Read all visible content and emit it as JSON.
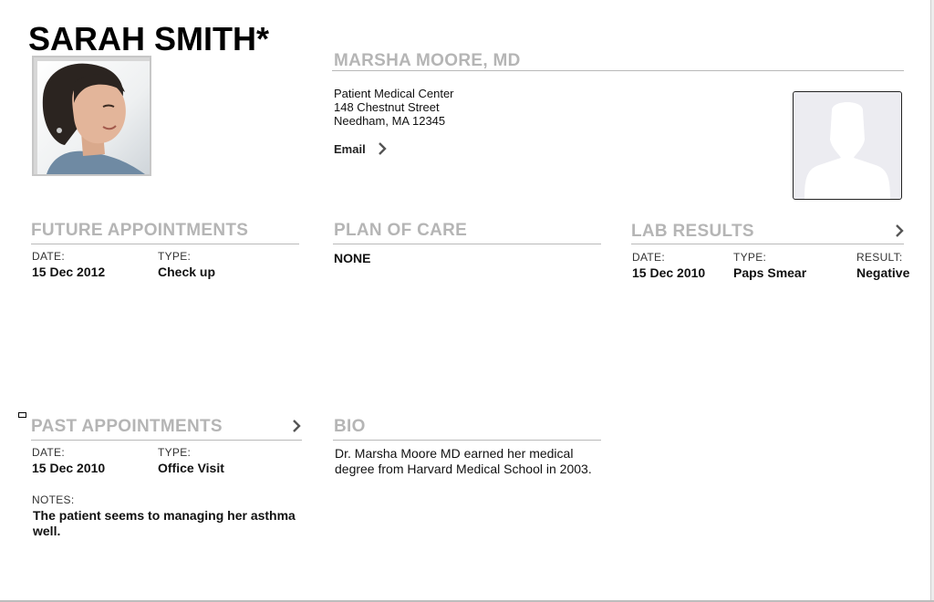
{
  "patient": {
    "name": "SARAH SMITH*"
  },
  "doctor": {
    "name": "MARSHA MOORE, MD",
    "address_line1": "Patient Medical Center",
    "address_line2": "148 Chestnut Street",
    "address_line3": "Needham, MA 12345",
    "email_label": "Email"
  },
  "future_appointments": {
    "title": "FUTURE APPOINTMENTS",
    "date_label": "DATE:",
    "type_label": "TYPE:",
    "date": "15 Dec 2012",
    "type": "Check up"
  },
  "plan_of_care": {
    "title": "PLAN OF CARE",
    "value": "NONE"
  },
  "lab_results": {
    "title": "LAB RESULTS",
    "date_label": "DATE:",
    "type_label": "TYPE:",
    "result_label": "RESULT:",
    "date": "15 Dec 2010",
    "type": "Paps Smear",
    "result": "Negative"
  },
  "past_appointments": {
    "title": "PAST APPOINTMENTS",
    "date_label": "DATE:",
    "type_label": "TYPE:",
    "date": "15 Dec 2010",
    "type": "Office Visit",
    "notes_label": "NOTES:",
    "notes_line1": "The patient seems to managing her asthma",
    "notes_line2": "well."
  },
  "bio": {
    "title": "BIO",
    "line1": "Dr. Marsha Moore MD earned her medical",
    "line2": "degree from Harvard Medical School in 2003."
  },
  "colors": {
    "section_title": "#b5b5b5",
    "rule": "#b9b9b9",
    "text": "#111111"
  }
}
